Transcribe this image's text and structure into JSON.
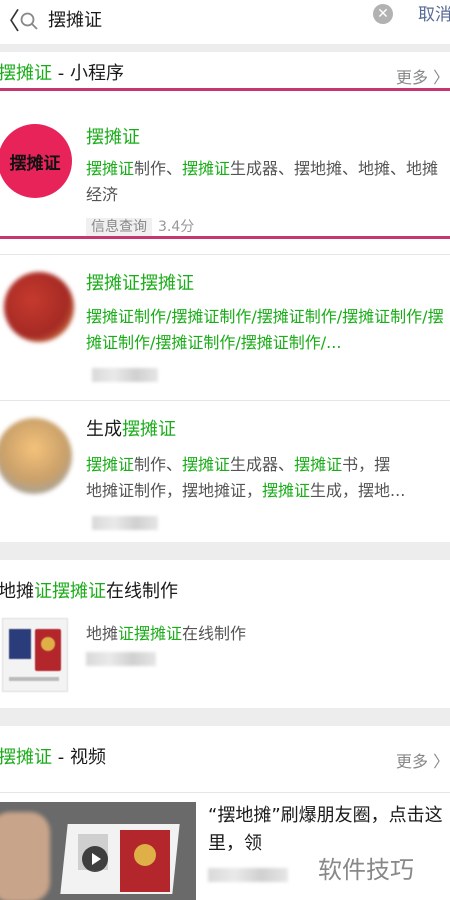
{
  "search": {
    "query": "摆摊证",
    "cancel_label": "取消"
  },
  "section_mini": {
    "title_highlight": "摆摊证",
    "title_rest": " - 小程序",
    "more_label": "更多 〉"
  },
  "app1": {
    "avatar_text": "摆摊证",
    "name": "摆摊证",
    "desc_parts": [
      "摆摊证",
      "制作、",
      "摆摊证",
      "生成器、摆地摊、地摊、地摊经济"
    ],
    "tag_label": "信息查询",
    "rating": "3.4分"
  },
  "app2": {
    "name": "摆摊证摆摊证",
    "desc": "摆摊证制作/摆摊证制作/摆摊证制作/摆摊证制作/摆摊证制作/摆摊证制作/摆摊证制作/..."
  },
  "app3": {
    "name_prefix": "生成",
    "name_highlight": "摆摊证",
    "desc_l1_parts": [
      "摆摊证",
      "制作、",
      "摆摊证",
      "生成器、",
      "摆摊证",
      "书，摆"
    ],
    "desc_l2_parts": [
      "地摊证制作，摆地摊证，",
      "摆摊证",
      "生成，摆地..."
    ]
  },
  "article": {
    "title_prefix": "地摊",
    "title_highlight": "证摆摊证",
    "title_rest": "在线制作",
    "summary_prefix": "地摊",
    "summary_highlight": "证摆摊证",
    "summary_rest": "在线制作"
  },
  "section_video": {
    "title_highlight": "摆摊证",
    "title_rest": " - 视频",
    "more_label": "更多 〉",
    "video_title": "“摆地摊”刷爆朋友圈，点击这里，领"
  },
  "watermark": "软件技巧",
  "colors": {
    "highlight": "#1aad19",
    "link": "#576b95",
    "red_line": "#c7376f",
    "avatar_red": "#e8235a"
  }
}
